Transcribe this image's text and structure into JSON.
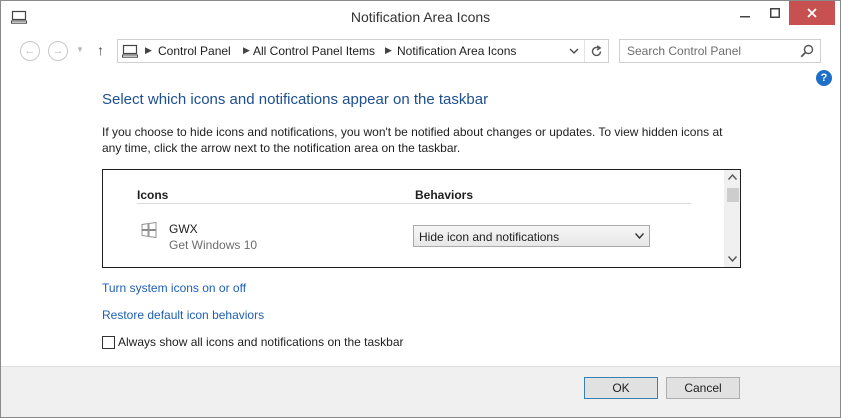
{
  "window": {
    "title": "Notification Area Icons",
    "close_color": "#c75050"
  },
  "navigation": {
    "breadcrumb": [
      "Control Panel",
      "All Control Panel Items",
      "Notification Area Icons"
    ]
  },
  "search": {
    "placeholder": "Search Control Panel"
  },
  "main": {
    "heading": "Select which icons and notifications appear on the taskbar",
    "description": "If you choose to hide icons and notifications, you won't be notified about changes or updates. To view hidden icons at any time, click the arrow next to the notification area on the taskbar.",
    "table": {
      "col_icons": "Icons",
      "col_behaviors": "Behaviors",
      "rows": [
        {
          "name": "GWX",
          "description": "Get Windows 10",
          "behavior": "Hide icon and notifications"
        }
      ]
    },
    "links": {
      "system_icons": "Turn system icons on or off",
      "restore_defaults": "Restore default icon behaviors"
    },
    "always_show": {
      "label": "Always show all icons and notifications on the taskbar",
      "checked": false
    }
  },
  "footer": {
    "ok": "OK",
    "cancel": "Cancel"
  },
  "colors": {
    "heading": "#1e4f90",
    "link": "#1e5fb3",
    "help_icon": "#1e6fc8"
  }
}
